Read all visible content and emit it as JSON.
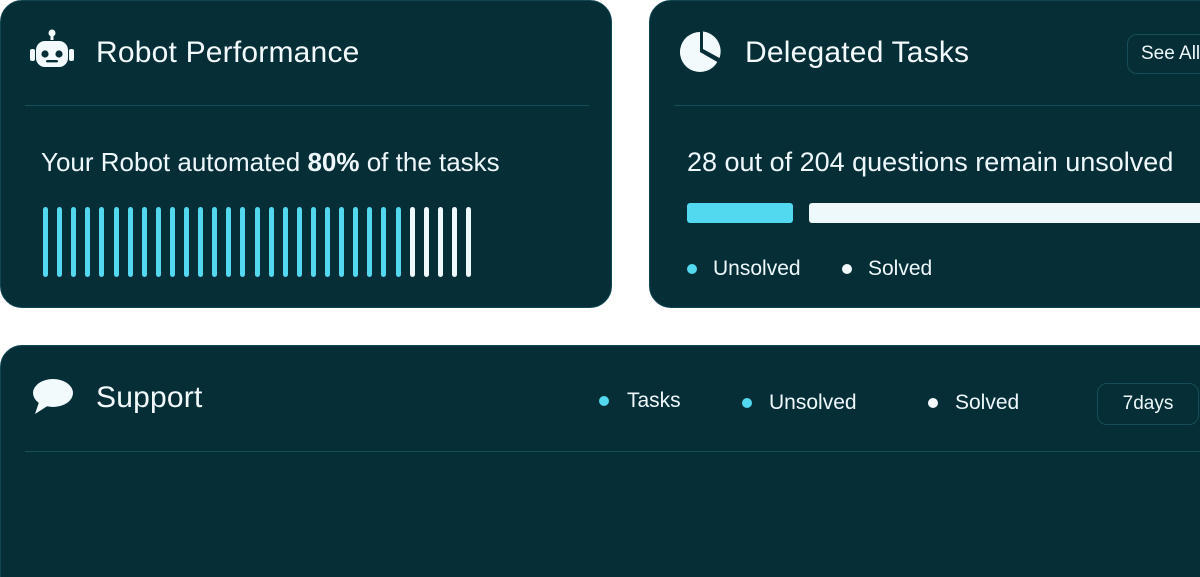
{
  "colors": {
    "card_background": "#062e37",
    "accent_cyan": "#52d8ef",
    "light": "#edf9fb",
    "divider": "#164e5a"
  },
  "robot_performance": {
    "title": "Robot Performance",
    "icon": "robot-icon",
    "summary_prefix": "Your Robot automated ",
    "summary_value": "80%",
    "summary_suffix": " of the tasks",
    "automated_fraction": 0.8,
    "bar_count": 31,
    "automated_bar_count": 26
  },
  "delegated_tasks": {
    "title": "Delegated Tasks",
    "icon": "pie-chart-icon",
    "see_all_label": "See All",
    "summary": "28 out of 204 questions remain unsolved",
    "unsolved": 28,
    "total": 204,
    "legend": [
      {
        "label": "Unsolved",
        "color": "#52d8ef"
      },
      {
        "label": "Solved",
        "color": "#edf9fb"
      }
    ]
  },
  "support": {
    "title": "Support",
    "icon": "chat-bubble-icon",
    "legend": [
      {
        "label": "Tasks",
        "color": "#52d8ef"
      },
      {
        "label": "Unsolved",
        "color": "#52d8ef"
      },
      {
        "label": "Solved",
        "color": "#edf9fb"
      }
    ],
    "range_label": "7days"
  }
}
